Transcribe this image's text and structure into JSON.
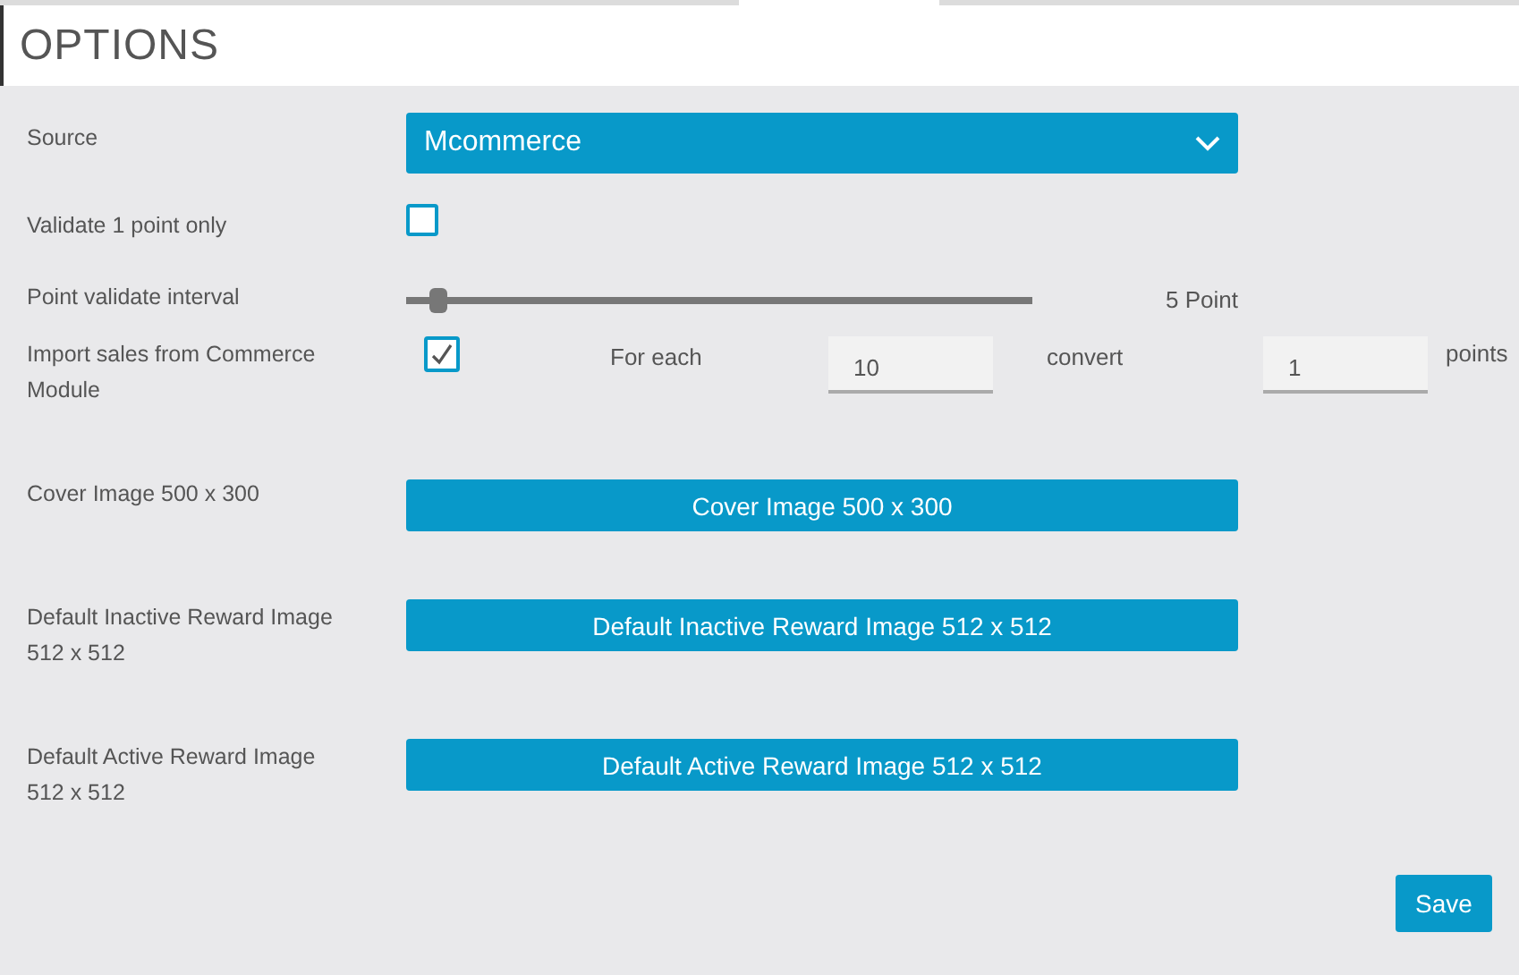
{
  "header": {
    "title": "OPTIONS"
  },
  "source": {
    "label": "Source",
    "value": "Mcommerce"
  },
  "validate_one": {
    "label": "Validate 1 point only",
    "checked": false
  },
  "interval": {
    "label": "Point validate interval",
    "level": 0.05,
    "reading": "5 Point"
  },
  "import_sales": {
    "label": "Import sales from Commerce Module",
    "checked": true,
    "for_each_label": "For each",
    "for_each_value": "10",
    "convert_label": "convert",
    "convert_value": "1",
    "points_label": "points"
  },
  "images": [
    {
      "label": "Cover Image 500 x 300",
      "button": "Cover Image 500 x 300"
    },
    {
      "label": "Default Inactive Reward Image 512 x 512",
      "button": "Default Inactive Reward Image 512 x 512"
    },
    {
      "label": "Default Active Reward Image 512 x 512",
      "button": "Default Active Reward Image 512 x 512"
    }
  ],
  "save_button": "Save"
}
